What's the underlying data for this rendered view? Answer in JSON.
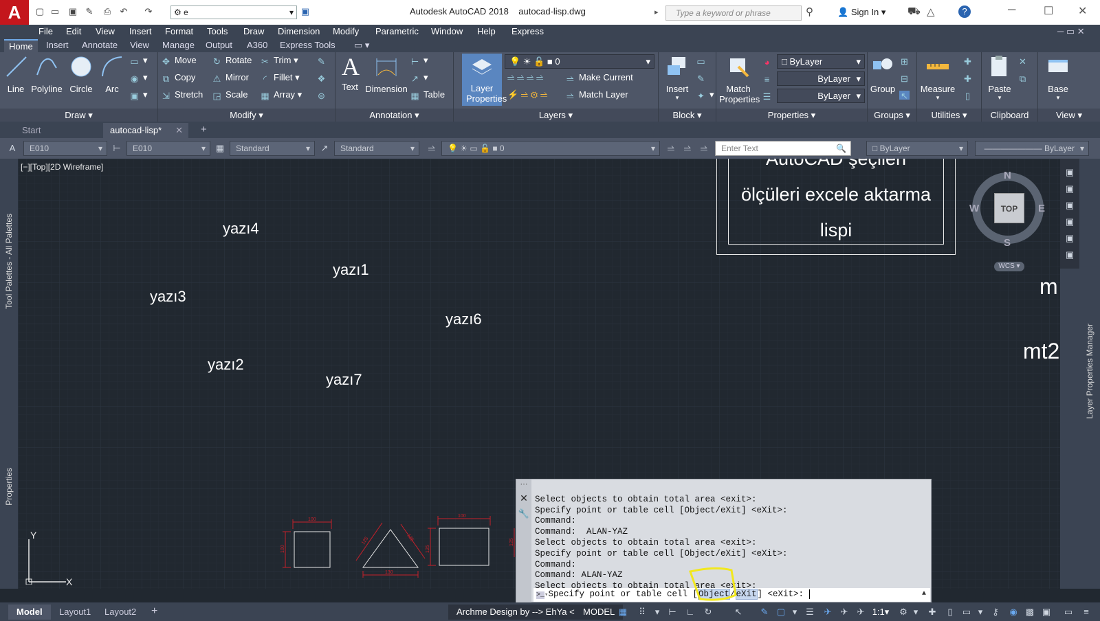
{
  "app": {
    "title": "Autodesk AutoCAD 2018",
    "file": "autocad-lisp.dwg",
    "workspace": "e",
    "search_placeholder": "Type a keyword or phrase",
    "signin": "Sign In"
  },
  "menus": [
    "File",
    "Edit",
    "View",
    "Insert",
    "Format",
    "Tools",
    "Draw",
    "Dimension",
    "Modify",
    "Parametric",
    "Window",
    "Help",
    "Express"
  ],
  "ribbon_tabs": [
    "Home",
    "Insert",
    "Annotate",
    "View",
    "Manage",
    "Output",
    "A360",
    "Express Tools"
  ],
  "ribbon": {
    "draw": {
      "label": "Draw",
      "line": "Line",
      "polyline": "Polyline",
      "circle": "Circle",
      "arc": "Arc"
    },
    "modify": {
      "label": "Modify",
      "move": "Move",
      "rotate": "Rotate",
      "trim": "Trim",
      "copy": "Copy",
      "mirror": "Mirror",
      "fillet": "Fillet",
      "stretch": "Stretch",
      "scale": "Scale",
      "array": "Array"
    },
    "annotation": {
      "label": "Annotation",
      "text": "Text",
      "dimension": "Dimension",
      "table": "Table"
    },
    "layers": {
      "label": "Layers",
      "layer_props": "Layer Properties",
      "current_layer": "0",
      "make_current": "Make Current",
      "match_layer": "Match Layer"
    },
    "block": {
      "label": "Block",
      "insert": "Insert"
    },
    "properties": {
      "label": "Properties",
      "match": "Match Properties",
      "color": "ByLayer",
      "linetype": "ByLayer",
      "lineweight": "ByLayer"
    },
    "groups": {
      "label": "Groups",
      "group": "Group"
    },
    "utilities": {
      "label": "Utilities",
      "measure": "Measure"
    },
    "clipboard": {
      "label": "Clipboard",
      "paste": "Paste"
    },
    "view": {
      "label": "View",
      "base": "Base"
    }
  },
  "doc_tabs": {
    "start": "Start",
    "active": "autocad-lisp*"
  },
  "propbar": {
    "dimstyle": "E010",
    "dimstyle2": "E010",
    "textstyle": "Standard",
    "tablestyle": "Standard",
    "layer": "0",
    "enter_text": "Enter Text",
    "color": "ByLayer",
    "linetype": "ByLayer"
  },
  "viewport": {
    "label": "[−][Top][2D Wireframe]"
  },
  "palettes": {
    "left_top": "Tool Palettes - All Palettes",
    "left_bottom": "Properties",
    "right": "Layer Properties Manager"
  },
  "drawing": {
    "texts": [
      "yazı4",
      "yazı1",
      "yazı3",
      "yazı6",
      "yazı2",
      "yazı7"
    ],
    "title_lines": [
      "AutoCAD şeçilen",
      "ölçüleri excele aktarma",
      "lispi"
    ],
    "right_texts": [
      "m",
      "mt2"
    ],
    "dims": [
      "100",
      "100",
      "125",
      "125",
      "130",
      "100",
      "125",
      "125"
    ]
  },
  "viewcube": {
    "n": "N",
    "s": "S",
    "e": "E",
    "w": "W",
    "top": "TOP",
    "wcs": "WCS"
  },
  "ucs": {
    "y": "Y",
    "x": "X"
  },
  "command": {
    "history": [
      "Select objects to obtain total area <exit>:",
      "Specify point or table cell [Object/eXit] <eXit>:",
      "Command:",
      "Command:  ALAN-YAZ",
      "Select objects to obtain total area <exit>:",
      "Specify point or table cell [Object/eXit] <eXit>:",
      "Command:",
      "Command: ALAN-YAZ",
      "Select objects to obtain total area <exit>:"
    ],
    "prompt_pre": "Specify point or table cell [",
    "opt1": "Object",
    "opt2": "eXit",
    "prompt_post": "] <eXit>: "
  },
  "status": {
    "model": "Model",
    "layout1": "Layout1",
    "layout2": "Layout2",
    "plugin": "Archme Design by --> EhYa <--",
    "space": "MODEL",
    "scale": "1:1"
  }
}
